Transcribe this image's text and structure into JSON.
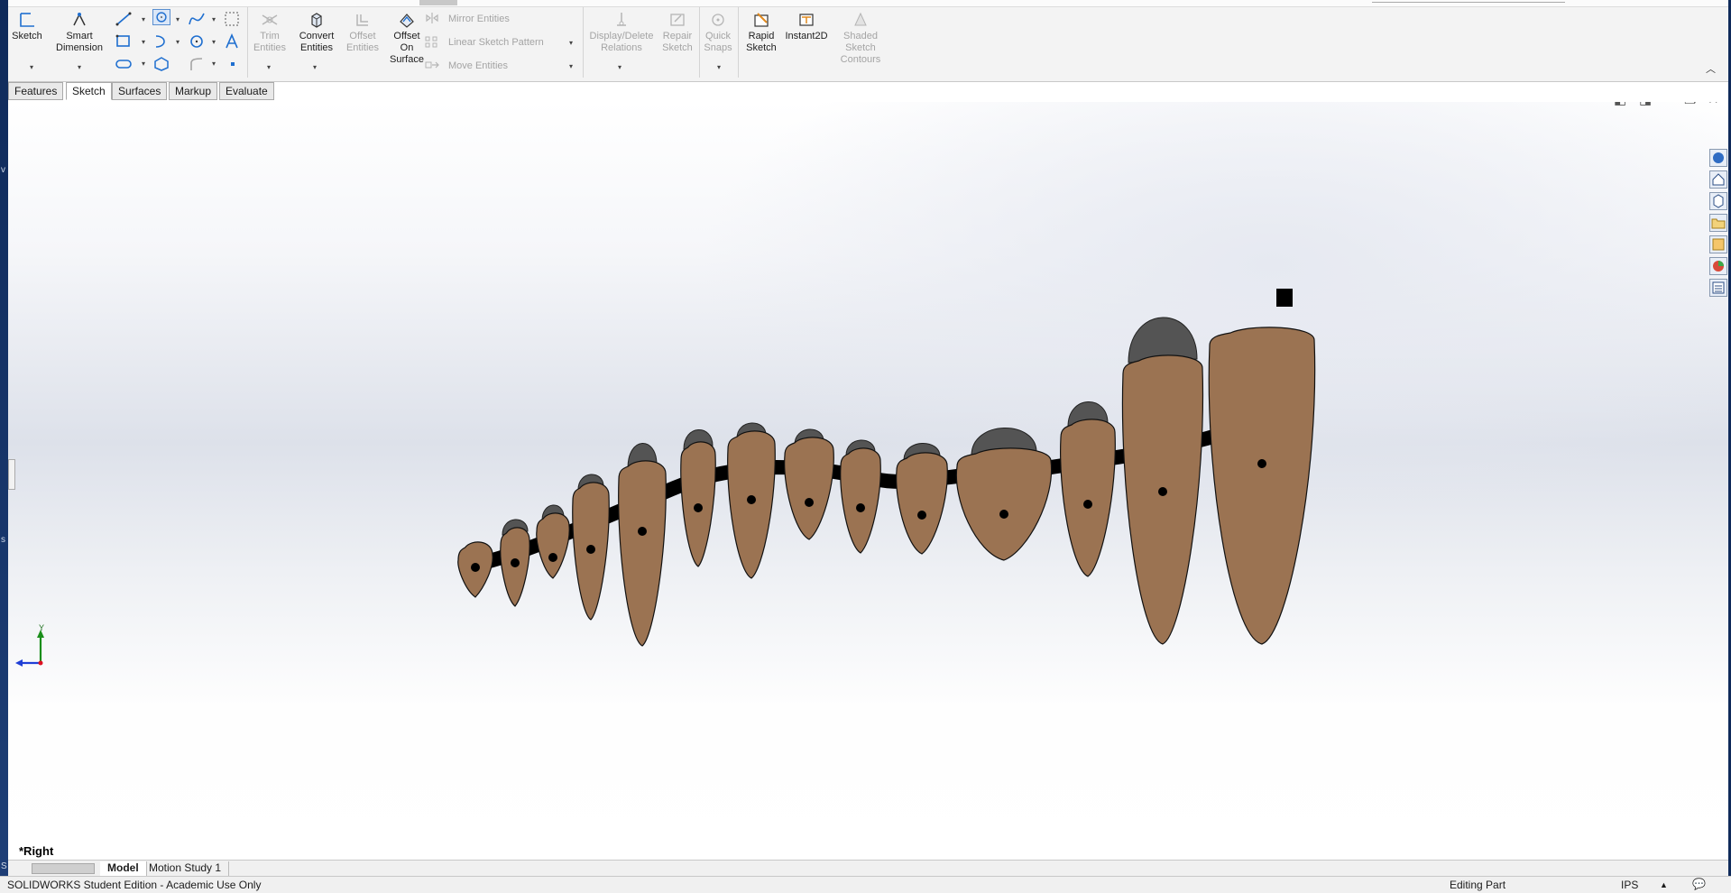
{
  "ribbon": {
    "sketch": "Sketch",
    "smart_dimension_1": "Smart",
    "smart_dimension_2": "Dimension",
    "trim_1": "Trim",
    "trim_2": "Entities",
    "convert_1": "Convert",
    "convert_2": "Entities",
    "offset_1": "Offset",
    "offset_2": "Entities",
    "offset_surface_1": "Offset",
    "offset_surface_2": "On",
    "offset_surface_3": "Surface",
    "mirror": "Mirror Entities",
    "linear_pattern": "Linear Sketch Pattern",
    "move": "Move Entities",
    "display_relations_1": "Display/Delete",
    "display_relations_2": "Relations",
    "repair_1": "Repair",
    "repair_2": "Sketch",
    "quick_snaps_1": "Quick",
    "quick_snaps_2": "Snaps",
    "rapid_1": "Rapid",
    "rapid_2": "Sketch",
    "instant2d": "Instant2D",
    "shaded_1": "Shaded",
    "shaded_2": "Sketch",
    "shaded_3": "Contours"
  },
  "tabs": [
    "Features",
    "Sketch",
    "Surfaces",
    "Markup",
    "Evaluate"
  ],
  "viewport": {
    "view_name": "*Right",
    "triad_y": "Y"
  },
  "bottom_tabs": [
    "Model",
    "Motion Study 1"
  ],
  "status": {
    "left": "SOLIDWORKS Student Edition - Academic Use Only",
    "mode": "Editing Part",
    "units": "IPS"
  },
  "colors": {
    "tooth_fill": "#9b7352",
    "cap_fill": "#545454",
    "spine": "#000000"
  }
}
